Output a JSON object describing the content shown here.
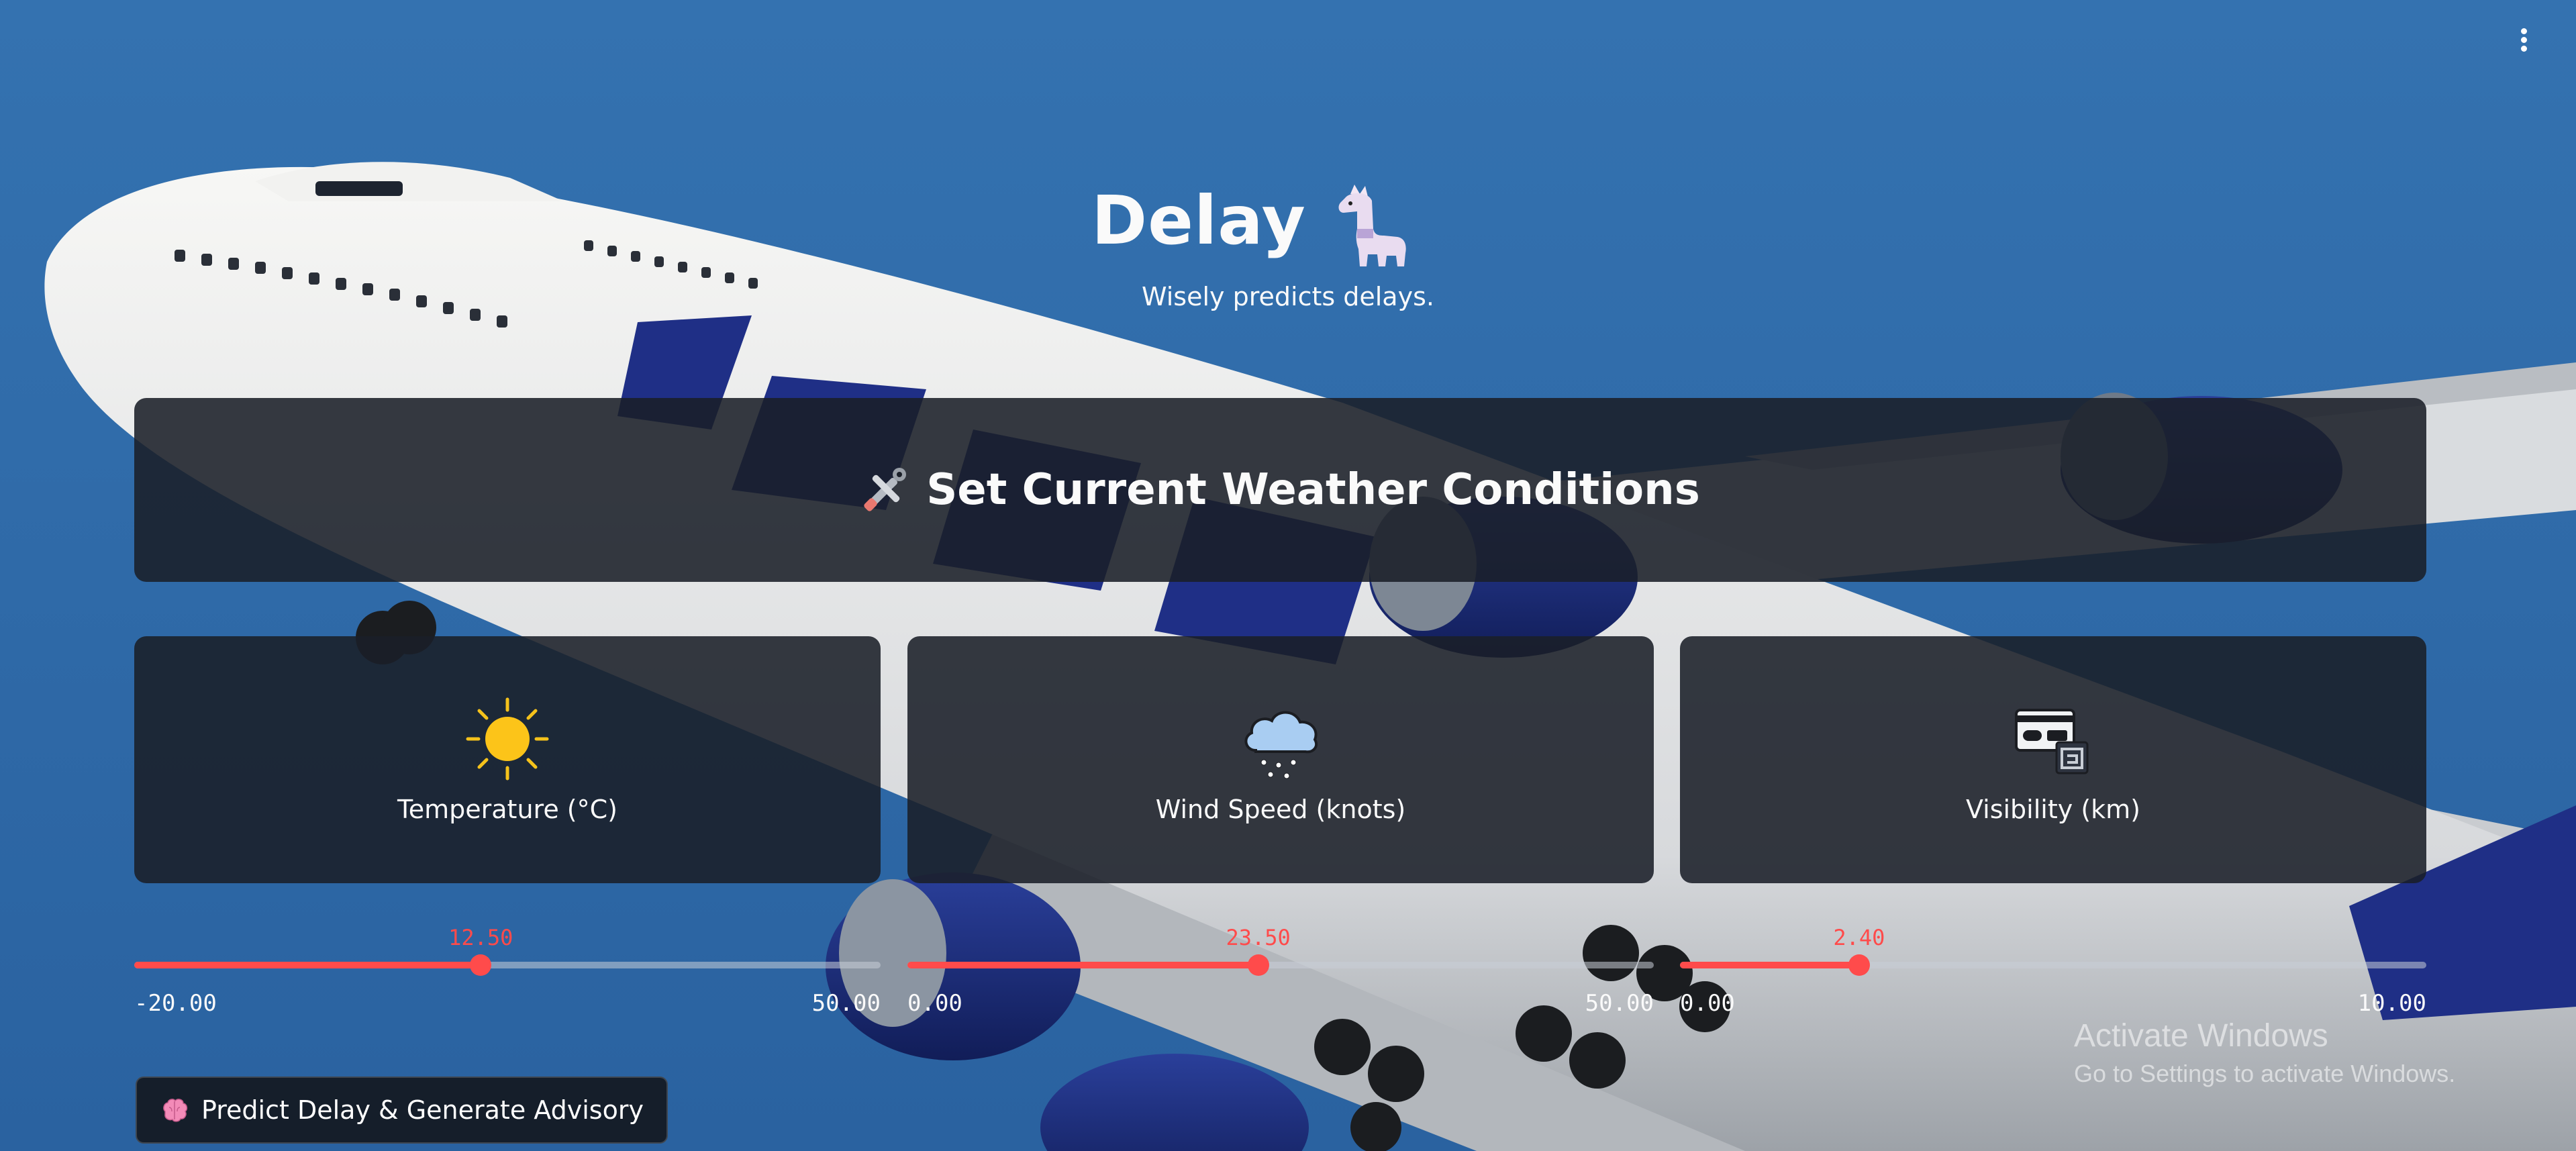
{
  "app": {
    "title": "Delay",
    "subtitle": "Wisely predicts delays."
  },
  "icons": {
    "menu": "vertical-ellipsis-icon",
    "title_emoji": "llama-icon",
    "section": "tools-icon",
    "temperature": "sun-icon",
    "wind": "snow-cloud-icon",
    "visibility": "id-card-icon",
    "predict": "brain-icon"
  },
  "section": {
    "heading": "Set Current Weather Conditions"
  },
  "cards": [
    {
      "label": "Temperature (°C)"
    },
    {
      "label": "Wind Speed (knots)"
    },
    {
      "label": "Visibility (km)"
    }
  ],
  "sliders": [
    {
      "name": "temperature",
      "value": 12.5,
      "value_label": "12.50",
      "min": -20,
      "max": 50,
      "min_label": "-20.00",
      "max_label": "50.00"
    },
    {
      "name": "wind_speed",
      "value": 23.5,
      "value_label": "23.50",
      "min": 0,
      "max": 50,
      "min_label": "0.00",
      "max_label": "50.00"
    },
    {
      "name": "visibility",
      "value": 2.4,
      "value_label": "2.40",
      "min": 0,
      "max": 10,
      "min_label": "0.00",
      "max_label": "10.00"
    }
  ],
  "actions": {
    "predict_label": "Predict Delay & Generate Advisory"
  },
  "watermark": {
    "line1": "Activate Windows",
    "line2": "Go to Settings to activate Windows."
  },
  "colors": {
    "accent": "#ff4b4b",
    "sky": "#2f6aa8",
    "panel": "#1a1f28"
  }
}
